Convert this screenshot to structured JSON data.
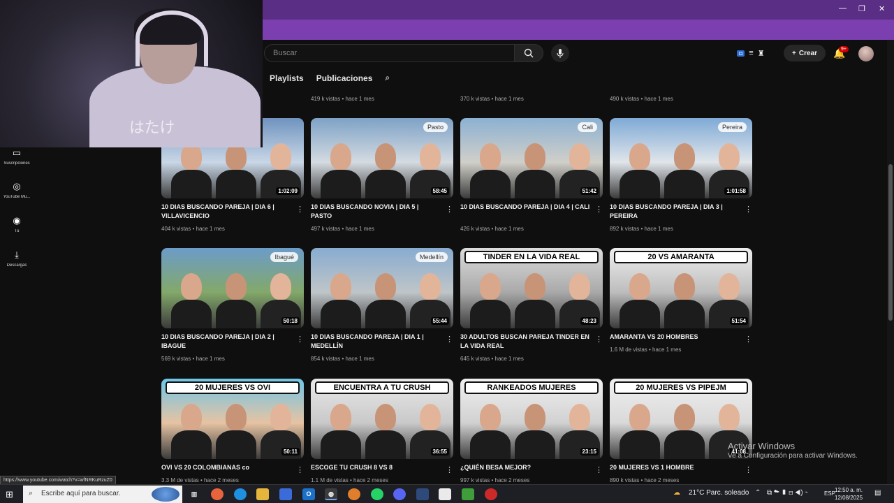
{
  "header": {
    "search_placeholder": "Buscar",
    "create_label": "Crear",
    "notif_count": "9+"
  },
  "channel_tabs": [
    "Playlists",
    "Publicaciones"
  ],
  "top_row": [
    {
      "meta": "419 k vistas • hace 1 mes"
    },
    {
      "meta": "370 k vistas • hace 1 mes"
    },
    {
      "meta": "490 k vistas • hace 1 mes"
    }
  ],
  "sidebar": [
    {
      "label": "Suscripciones",
      "icon": "subscriptions-icon"
    },
    {
      "label": "YouTube Mu...",
      "icon": "youtube-music-icon"
    },
    {
      "label": "Tú",
      "icon": "you-icon"
    },
    {
      "label": "Descargas",
      "icon": "downloads-icon"
    }
  ],
  "videos": [
    {
      "title": "10 DIAS BUSCANDO PAREJA | DIA 6 | VILLAVICENCIO",
      "meta": "404 k vistas • hace 1 mes",
      "duration": "1:02:09",
      "pin": "",
      "banner": "",
      "colors": [
        "#6f93bf",
        "#c9d7e6"
      ]
    },
    {
      "title": "10 DIAS BUSCANDO NOVIA | DIA 5 | PASTO",
      "meta": "497 k vistas • hace 1 mes",
      "duration": "58:45",
      "pin": "Pasto",
      "banner": "",
      "colors": [
        "#7ea2c6",
        "#d4dbe1"
      ]
    },
    {
      "title": "10 DIAS BUSCANDO PAREJA | DIA 4 | CALI",
      "meta": "426 k vistas • hace 1 mes",
      "duration": "51:42",
      "pin": "Cali",
      "banner": "",
      "colors": [
        "#8cb1d2",
        "#d0cfc9"
      ]
    },
    {
      "title": "10 DIAS BUSCANDO PAREJA | DIA 3 | PEREIRA",
      "meta": "892 k vistas • hace 1 mes",
      "duration": "1:01:58",
      "pin": "Pereira",
      "banner": "",
      "colors": [
        "#7faad6",
        "#e0e5ea"
      ]
    },
    {
      "title": "10 DIAS BUSCANDO PAREJA | DIA 2 | IBAGUE",
      "meta": "569 k vistas • hace 1 mes",
      "duration": "50:18",
      "pin": "Ibagué",
      "banner": "",
      "colors": [
        "#6c9cc9",
        "#83a86a"
      ]
    },
    {
      "title": "10 DIAS BUSCANDO PAREJA | DIA 1 | MEDELLÍN",
      "meta": "854 k vistas • hace 1 mes",
      "duration": "55:44",
      "pin": "Medellín",
      "banner": "",
      "colors": [
        "#88acd0",
        "#bfc5c8"
      ]
    },
    {
      "title": "30 ADULTOS BUSCAN PAREJA TINDER EN LA VIDA REAL",
      "meta": "645 k vistas • hace 1 mes",
      "duration": "48:23",
      "pin": "",
      "banner": "TINDER EN LA VIDA REAL",
      "colors": [
        "#dcdcdc",
        "#a9a9a9"
      ]
    },
    {
      "title": "AMARANTA VS 20 HOMBRES",
      "meta": "1.6 M de vistas • hace 1 mes",
      "duration": "51:54",
      "pin": "",
      "banner": "20 VS AMARANTA",
      "colors": [
        "#efefef",
        "#bdbdbd"
      ]
    },
    {
      "title": "OVI VS 20 COLOMBIANAS co",
      "meta": "3.3 M de vistas • hace 2 meses",
      "duration": "50:11",
      "pin": "",
      "banner": "20 MUJERES VS OVI",
      "colors": [
        "#6fc6e8",
        "#e6c3a3"
      ]
    },
    {
      "title": "ESCOGE TU CRUSH 8 VS 8",
      "meta": "1.1 M de vistas • hace 2 meses",
      "duration": "36:55",
      "pin": "",
      "banner": "ENCUENTRA A TU CRUSH",
      "colors": [
        "#e9e9e9",
        "#c9c9c9"
      ]
    },
    {
      "title": "¿QUIÉN BESA MEJOR?",
      "meta": "997 k vistas • hace 2 meses",
      "duration": "23:15",
      "pin": "",
      "banner": "RANKEADOS      MUJERES",
      "colors": [
        "#f1f1f1",
        "#d1d1d1"
      ]
    },
    {
      "title": "20 MUJERES VS 1 HOMBRE",
      "meta": "890 k vistas • hace 2 meses",
      "duration": "41:08",
      "pin": "",
      "banner": "20 MUJERES VS PIPEJM",
      "colors": [
        "#f0f0f0",
        "#d9d9d9"
      ]
    }
  ],
  "webcam": {
    "glyph": "はたけ"
  },
  "status_url": "https://www.youtube.com/watch?v=wfNRKuRzuZ0",
  "watermark": {
    "line1": "Activar Windows",
    "line2": "Ve a Configuración para activar Windows."
  },
  "taskbar": {
    "search_placeholder": "Escribe aquí para buscar.",
    "weather": "21°C  Parc. soleado",
    "lang": "ESP",
    "time": "12:50 a. m.",
    "date": "12/08/2025"
  }
}
